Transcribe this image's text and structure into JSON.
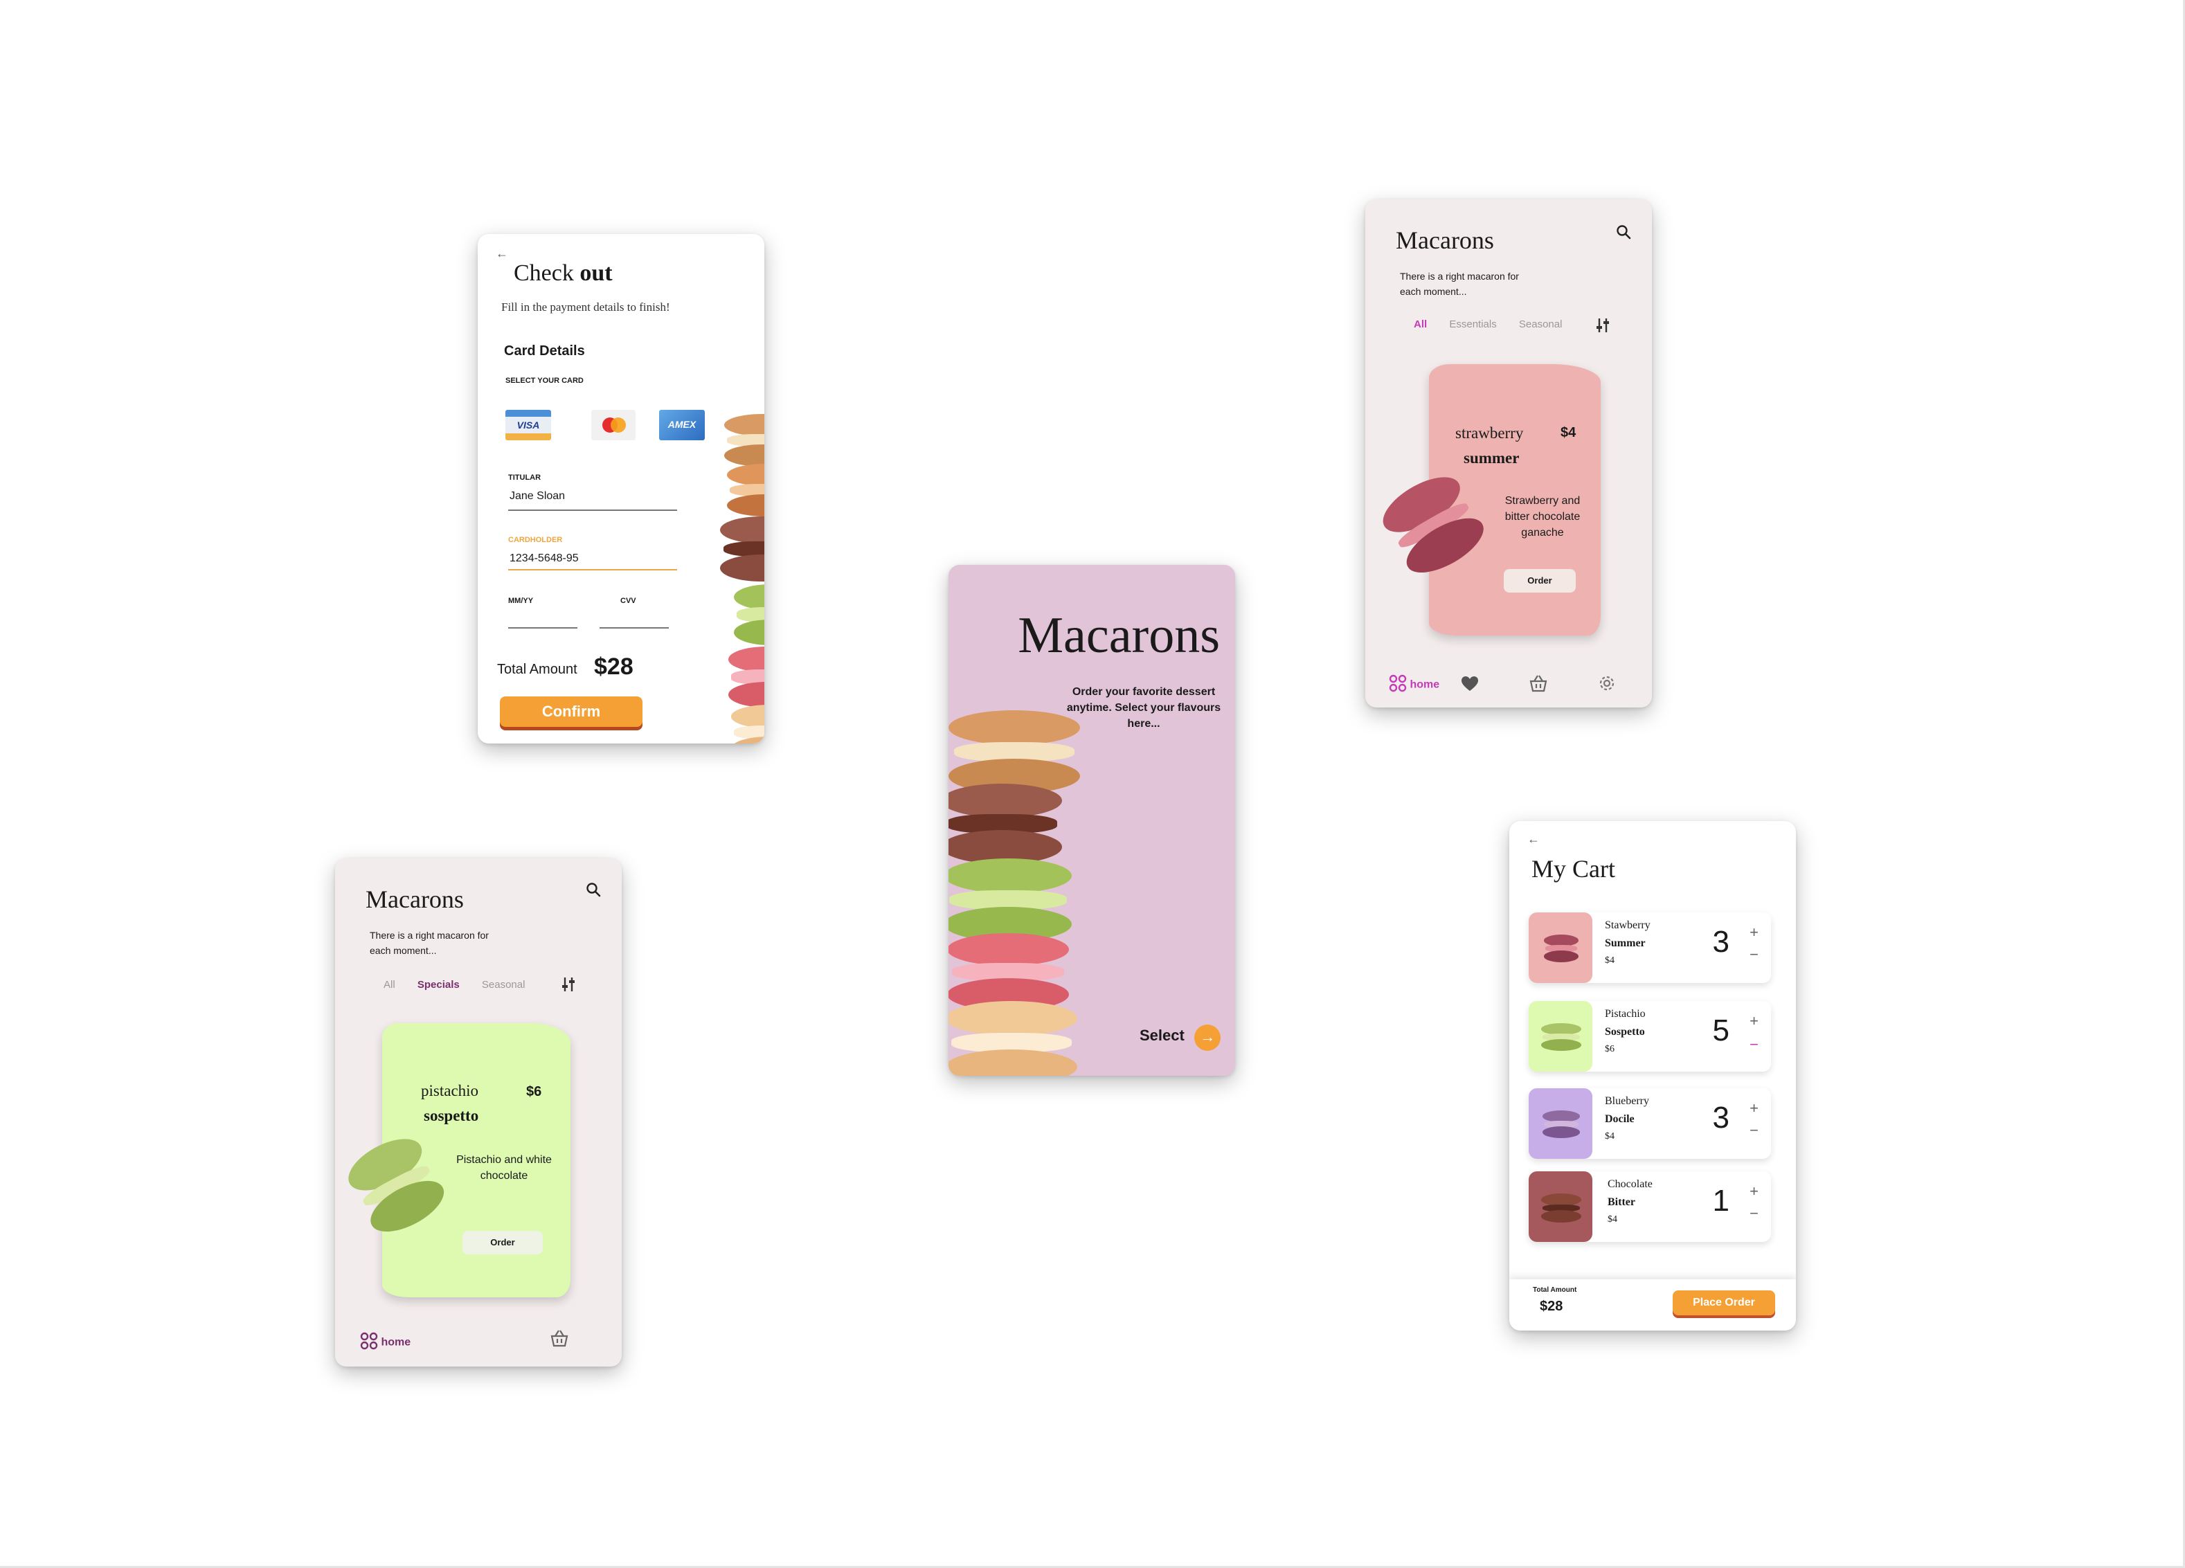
{
  "checkout": {
    "back": "←",
    "title_a": "Check ",
    "title_b": "out",
    "subtitle": "Fill in the payment details to finish!",
    "section": "Card Details",
    "select_card": "SELECT YOUR CARD",
    "cards": [
      "VISA",
      "",
      "AMEX"
    ],
    "titular_label": "TITULAR",
    "titular_value": "Jane Sloan",
    "cardholder_label": "CARDHOLDER",
    "cardholder_value": "1234-5648-95",
    "mmyy_label": "MM/YY",
    "cvv_label": "CVV",
    "total_label": "Total Amount",
    "total_value": "$28",
    "confirm": "Confirm"
  },
  "splash": {
    "title": "Macarons",
    "tagline": "Order your favorite dessert anytime. Select your flavours here...",
    "select": "Select"
  },
  "home_strawberry": {
    "title": "Macarons",
    "subtitle": "There is a right macaron for each moment...",
    "tabs": [
      "All",
      "Essentials",
      "Seasonal"
    ],
    "product_name_a": "strawberry",
    "product_name_b": "summer",
    "price": "$4",
    "description": "Strawberry and bitter chocolate ganache",
    "order": "Order",
    "nav_home": "home"
  },
  "home_pistachio": {
    "title": "Macarons",
    "subtitle": "There is a right macaron for each moment...",
    "tabs": [
      "All",
      "Specials",
      "Seasonal"
    ],
    "product_name_a": "pistachio",
    "product_name_b": "sospetto",
    "price": "$6",
    "description": "Pistachio and white chocolate",
    "order": "Order",
    "nav_home": "home"
  },
  "cart": {
    "back": "←",
    "title": "My Cart",
    "items": [
      {
        "name": "Stawberry",
        "variant": "Summer",
        "price": "$4",
        "qty": "3"
      },
      {
        "name": "Pistachio",
        "variant": "Sospetto",
        "price": "$6",
        "qty": "5"
      },
      {
        "name": "Blueberry",
        "variant": "Docile",
        "price": "$4",
        "qty": "3"
      },
      {
        "name": "Chocolate",
        "variant": "Bitter",
        "price": "$4",
        "qty": "1"
      }
    ],
    "plus": "+",
    "minus": "−",
    "total_label": "Total Amount",
    "total_value": "$28",
    "place_order": "Place Order"
  },
  "colors": {
    "accent_orange": "#f5a035",
    "accent_magenta": "#c43bb8",
    "splash_bg": "#e2c4d8",
    "pink_card": "#eeb3b0",
    "green_card": "#ddfab0"
  }
}
